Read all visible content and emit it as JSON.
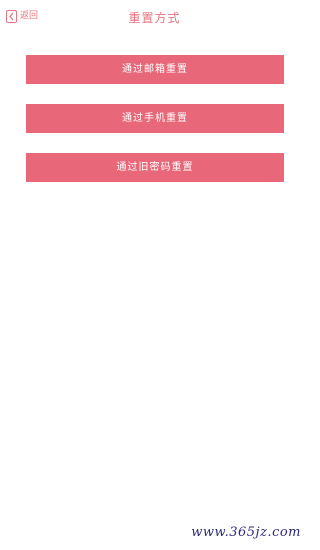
{
  "header": {
    "back_label": "返回",
    "title": "重置方式"
  },
  "options": [
    {
      "label": "通过邮箱重置"
    },
    {
      "label": "通过手机重置"
    },
    {
      "label": "通过旧密码重置"
    }
  ],
  "watermark": "www.365jz.com",
  "colors": {
    "accent": "#e8687a",
    "header_text": "#e8737f",
    "background": "#ffffff"
  },
  "icons": {
    "back": "back-icon"
  }
}
